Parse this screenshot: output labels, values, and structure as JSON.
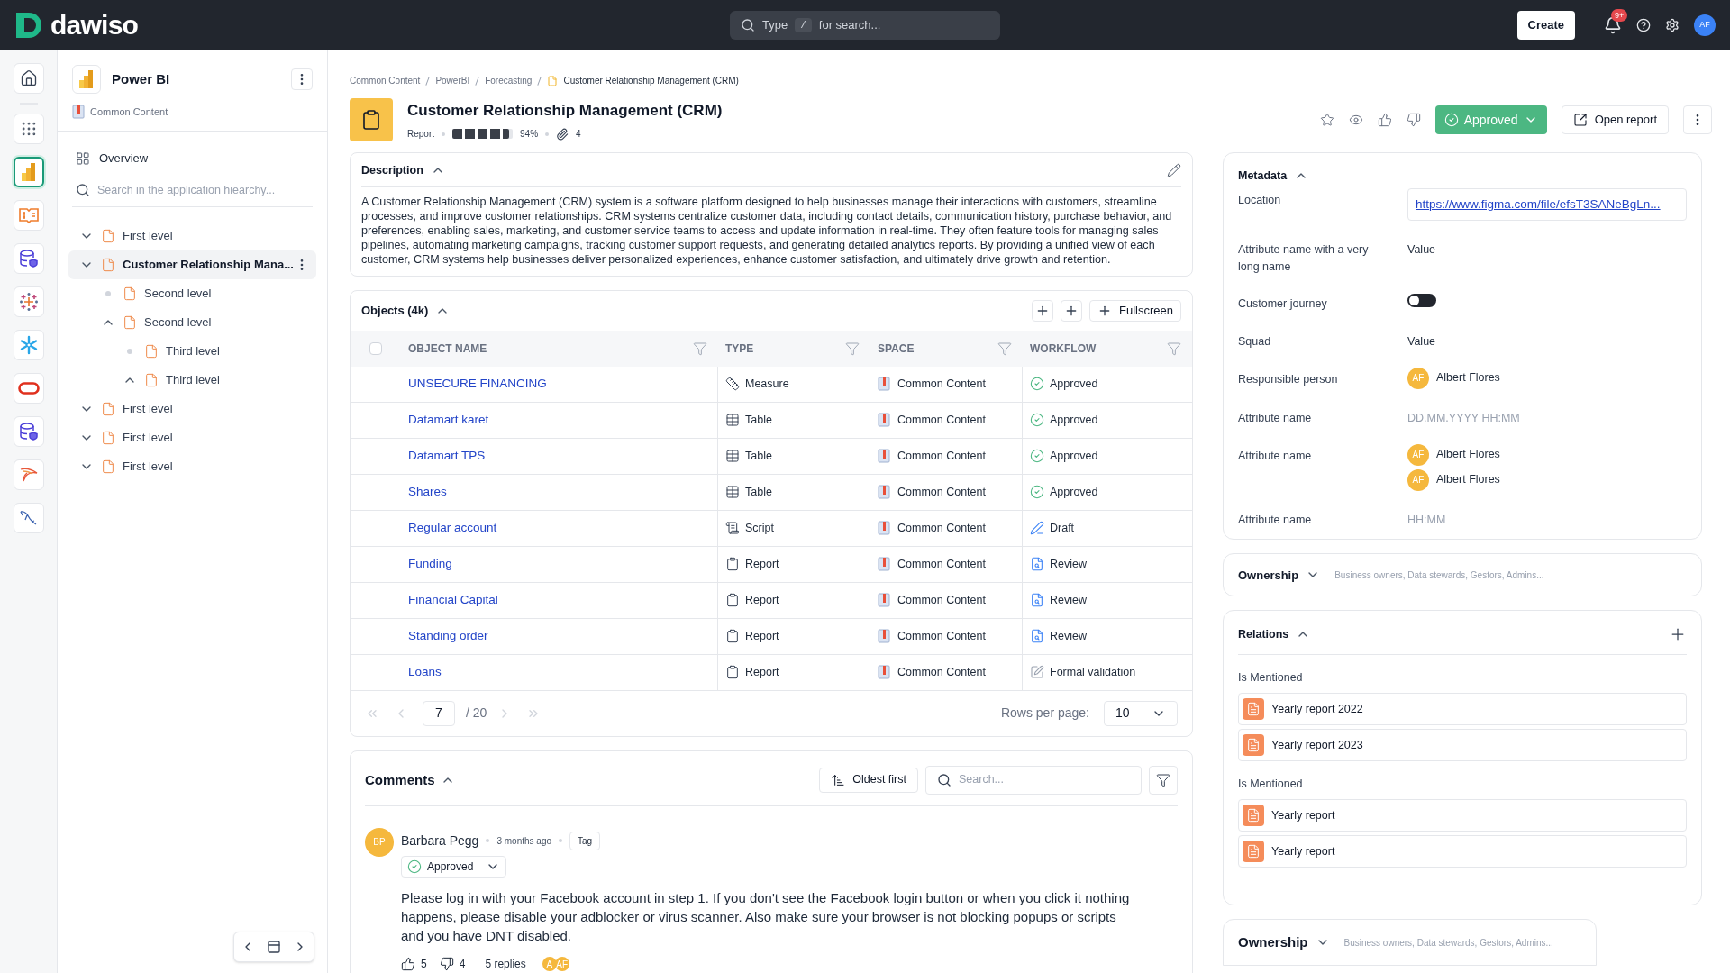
{
  "topbar": {
    "logo": "dawiso",
    "search": {
      "prefix": "Type",
      "key": "/",
      "suffix": "for search..."
    },
    "create": "Create",
    "notifications": "9+",
    "avatar": "AF"
  },
  "rail": [
    {
      "kind": "home",
      "selected": false
    },
    {
      "kind": "apps",
      "selected": false
    },
    {
      "kind": "powerbi",
      "selected": true
    },
    {
      "kind": "glossary",
      "selected": false
    },
    {
      "kind": "database",
      "selected": false
    },
    {
      "kind": "tableau",
      "selected": false
    },
    {
      "kind": "snowflake",
      "selected": false
    },
    {
      "kind": "oracle",
      "selected": false
    },
    {
      "kind": "database",
      "selected": false
    },
    {
      "kind": "bird",
      "selected": false
    },
    {
      "kind": "dolphin",
      "selected": false
    }
  ],
  "tree": {
    "title": "Power BI",
    "space": "Common Content",
    "overview": "Overview",
    "search": {
      "placeholder": "Search in the application hiearchy..."
    },
    "items": [
      {
        "label": "First level",
        "kind": "down",
        "selected": false
      },
      {
        "label": "Customer Relationship Mana...",
        "kind": "down",
        "selected": true,
        "children": [
          {
            "label": "Second level",
            "kind": "leaf",
            "selected": false
          },
          {
            "label": "Second level",
            "kind": "up",
            "selected": false,
            "children": [
              {
                "label": "Third level",
                "kind": "leaf",
                "selected": false
              },
              {
                "label": "Third level",
                "kind": "up",
                "selected": false
              }
            ]
          }
        ]
      },
      {
        "label": "First level",
        "kind": "down",
        "selected": false
      },
      {
        "label": "First level",
        "kind": "down",
        "selected": false
      },
      {
        "label": "First level",
        "kind": "down",
        "selected": false
      }
    ]
  },
  "breadcrumbs": [
    "Common Content",
    "PowerBI",
    "Forecasting",
    "Customer Relationship Management (CRM)"
  ],
  "header": {
    "title": "Customer Relationship Management (CRM)",
    "type": "Report",
    "quality": {
      "level": 0.94,
      "reading": "94%"
    },
    "attachments": "4",
    "status": "Approved",
    "open": "Open report"
  },
  "description": {
    "title": "Description",
    "text": "A Customer Relationship Management (CRM) system is a software platform designed to help businesses manage their interactions with customers, streamline processes, and improve customer relationships. CRM systems centralize customer data, including contact details, communication history, purchase behavior, and preferences, enabling sales, marketing, and customer service teams to access and update information in real-time. They often feature tools for managing sales pipelines, automating marketing campaigns, tracking customer support requests, and generating detailed analytics reports. By providing a unified view of each customer, CRM systems help businesses deliver personalized experiences, enhance customer satisfaction, and ultimately drive growth and retention."
  },
  "objects": {
    "title": "Objects (4k)",
    "fullscreen": "Fullscreen",
    "select_all": {
      "checked": false
    },
    "columns": [
      "OBJECT NAME",
      "TYPE",
      "SPACE",
      "WORKFLOW"
    ],
    "rows": [
      {
        "name": "UNSECURE FINANCING",
        "type": {
          "kind": "measure",
          "label": "Measure"
        },
        "space": "Common Content",
        "workflow": {
          "kind": "approved",
          "label": "Approved"
        }
      },
      {
        "name": "Datamart karet",
        "type": {
          "kind": "table",
          "label": "Table"
        },
        "space": "Common Content",
        "workflow": {
          "kind": "approved",
          "label": "Approved"
        }
      },
      {
        "name": "Datamart TPS",
        "type": {
          "kind": "table",
          "label": "Table"
        },
        "space": "Common Content",
        "workflow": {
          "kind": "approved",
          "label": "Approved"
        }
      },
      {
        "name": "Shares",
        "type": {
          "kind": "table",
          "label": "Table"
        },
        "space": "Common Content",
        "workflow": {
          "kind": "approved",
          "label": "Approved"
        }
      },
      {
        "name": "Regular account",
        "type": {
          "kind": "script",
          "label": "Script"
        },
        "space": "Common Content",
        "workflow": {
          "kind": "draft",
          "label": "Draft"
        }
      },
      {
        "name": "Funding",
        "type": {
          "kind": "report",
          "label": "Report"
        },
        "space": "Common Content",
        "workflow": {
          "kind": "review",
          "label": "Review"
        }
      },
      {
        "name": "Financial Capital",
        "type": {
          "kind": "report",
          "label": "Report"
        },
        "space": "Common Content",
        "workflow": {
          "kind": "review",
          "label": "Review"
        }
      },
      {
        "name": "Standing order",
        "type": {
          "kind": "report",
          "label": "Report"
        },
        "space": "Common Content",
        "workflow": {
          "kind": "review",
          "label": "Review"
        }
      },
      {
        "name": "Loans",
        "type": {
          "kind": "report",
          "label": "Report"
        },
        "space": "Common Content",
        "workflow": {
          "kind": "validation",
          "label": "Formal validation"
        }
      }
    ],
    "pagination": {
      "page": "7",
      "total": "/ 20",
      "rows_label": "Rows per page:",
      "rows": "10"
    }
  },
  "comments": {
    "title": "Comments",
    "sort": "Oldest first",
    "search": {
      "placeholder": "Search..."
    },
    "items": [
      {
        "initials": "BP",
        "author": "Barbara Pegg",
        "time": "3 months ago",
        "tag": "Tag",
        "status": "Approved",
        "text": "Please log in with your Facebook account in step 1. If you don't see the Facebook login button or when you click it nothing happens, please disable your adblocker or virus scanner. Also make sure your browser is not blocking popups or scripts and you have DNT disabled.",
        "likes": "5",
        "dislikes": "4",
        "replies": "5 replies",
        "reply_avatars": [
          "A",
          "AF"
        ]
      }
    ]
  },
  "metadata": {
    "title": "Metadata",
    "rows": [
      {
        "kind": "link",
        "label": "Location",
        "value": "https://www.figma.com/file/efsT3SANeBgLn..."
      },
      {
        "kind": "text",
        "label": "Attribute name with a very long name",
        "value": "Value"
      },
      {
        "kind": "toggle",
        "label": "Customer journey",
        "on": false
      },
      {
        "kind": "text",
        "label": "Squad",
        "value": "Value"
      },
      {
        "kind": "people",
        "label": "Responsible person",
        "people": [
          {
            "initials": "AF",
            "name": "Albert Flores"
          }
        ]
      },
      {
        "kind": "placeholder",
        "label": "Attribute name",
        "placeholder": "DD.MM.YYYY HH:MM"
      },
      {
        "kind": "people",
        "label": "Attribute name",
        "people": [
          {
            "initials": "AF",
            "name": "Albert Flores"
          },
          {
            "initials": "AF",
            "name": "Albert Flores"
          }
        ]
      },
      {
        "kind": "placeholder",
        "label": "Attribute name",
        "placeholder": "HH:MM"
      }
    ]
  },
  "ownership": {
    "title": "Ownership",
    "summary": "Business owners, Data stewards, Gestors, Admins..."
  },
  "relations": {
    "title": "Relations",
    "groups": [
      {
        "label": "Is Mentioned",
        "items": [
          "Yearly report 2022",
          "Yearly report 2023"
        ]
      },
      {
        "label": "Is Mentioned",
        "items": [
          "Yearly report",
          "Yearly report"
        ]
      }
    ]
  },
  "ownership_bottom": {
    "title": "Ownership",
    "summary": "Business owners, Data stewards, Gestors, Admins..."
  }
}
